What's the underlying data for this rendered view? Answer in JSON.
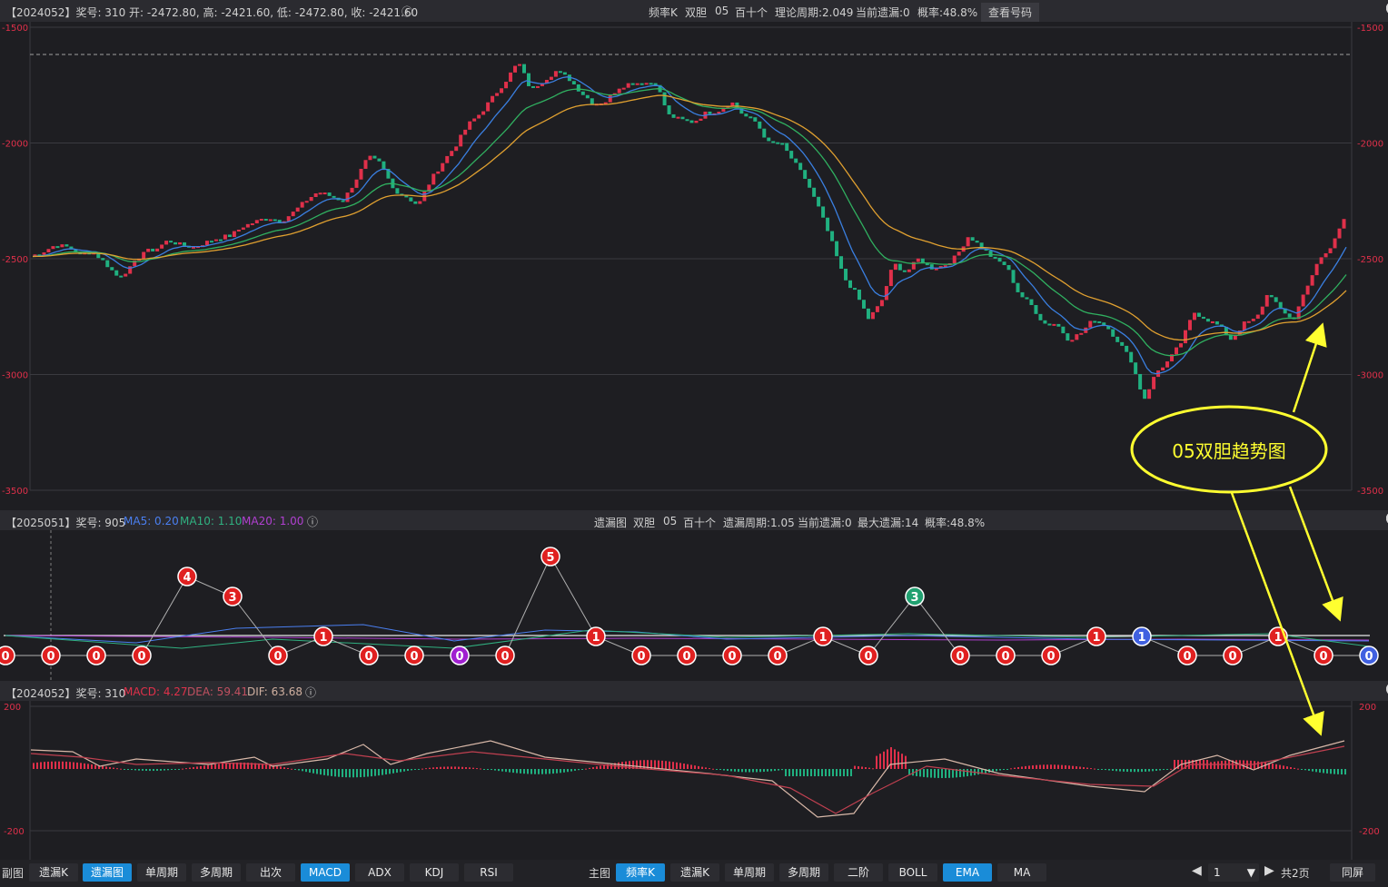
{
  "top_header": {
    "info": "【2024052】奖号: 310  开: -2472.80, 高: -2421.60, 低: -2472.80, 收: -2421.60",
    "chart_name": "频率K",
    "type": "双胆",
    "number": "05",
    "position": "百十个",
    "period": "理论周期:2.049",
    "omit": "当前遗漏:0",
    "prob": "概率:48.8%",
    "view_btn": "查看号码"
  },
  "mid_header": {
    "info": "【2025051】奖号: 905",
    "ma5": "MA5: 0.20",
    "ma10": "MA10: 1.10",
    "ma20": "MA20: 1.00",
    "chart_name": "遗漏图",
    "type": "双胆",
    "number": "05",
    "position": "百十个",
    "period": "遗漏周期:1.05",
    "omit": "当前遗漏:0",
    "max_omit": "最大遗漏:14",
    "prob": "概率:48.8%"
  },
  "bottom_header": {
    "info": "【2024052】奖号: 310",
    "macd": "MACD: 4.27",
    "dea": "DEA: 59.41",
    "dif": "DIF: 63.68"
  },
  "annotation": "05双胆趋势图",
  "colors": {
    "up": "#e0304a",
    "down": "#20b080",
    "ma_blue": "#3a7fe0",
    "ma_green": "#30b060",
    "ma_orange": "#e0a030",
    "note": "#ffff30"
  },
  "main_chart": {
    "y_ticks": [
      "-1500",
      "-2000",
      "-2500",
      "-3000",
      "-3500"
    ],
    "price_path": [
      -2490,
      -2470,
      -2440,
      -2450,
      -2480,
      -2470,
      -2520,
      -2580,
      -2540,
      -2470,
      -2460,
      -2420,
      -2440,
      -2450,
      -2430,
      -2410,
      -2400,
      -2360,
      -2340,
      -2320,
      -2340,
      -2300,
      -2250,
      -2210,
      -2230,
      -2250,
      -2160,
      -2060,
      -2090,
      -2200,
      -2230,
      -2270,
      -2160,
      -2080,
      -2010,
      -1920,
      -1870,
      -1800,
      -1730,
      -1650,
      -1770,
      -1730,
      -1690,
      -1720,
      -1780,
      -1830,
      -1820,
      -1760,
      -1740,
      -1740,
      -1740,
      -1880,
      -1900,
      -1910,
      -1870,
      -1860,
      -1820,
      -1880,
      -1910,
      -2000,
      -2000,
      -2080,
      -2160,
      -2280,
      -2420,
      -2580,
      -2650,
      -2760,
      -2690,
      -2520,
      -2560,
      -2500,
      -2540,
      -2530,
      -2490,
      -2400,
      -2450,
      -2500,
      -2530,
      -2650,
      -2700,
      -2780,
      -2780,
      -2850,
      -2820,
      -2760,
      -2790,
      -2860,
      -2940,
      -3110,
      -2990,
      -2940,
      -2860,
      -2730,
      -2760,
      -2790,
      -2850,
      -2780,
      -2760,
      -2640,
      -2730,
      -2760,
      -2620,
      -2510,
      -2450,
      -2320
    ]
  },
  "omission_chart": {
    "values": [
      "0",
      "0",
      "0",
      "0",
      "4",
      "3",
      "0",
      "1",
      "0",
      "0",
      "0",
      "0",
      "5",
      "1",
      "0",
      "0",
      "0",
      "0",
      "1",
      "0",
      "3",
      "0",
      "0",
      "0",
      "1",
      "1",
      "0",
      "0",
      "1",
      "0",
      "0"
    ],
    "xs": [
      6,
      56,
      106,
      156,
      206,
      256,
      306,
      356,
      406,
      456,
      506,
      556,
      606,
      656,
      706,
      756,
      806,
      856,
      906,
      956,
      1007,
      1057,
      1107,
      1157,
      1207,
      1257,
      1307,
      1357,
      1407,
      1457,
      1507
    ],
    "purple": [
      10
    ],
    "blue": [
      25,
      30
    ],
    "green": [
      20
    ]
  },
  "macd_chart": {
    "y_ticks": [
      "200",
      "-200"
    ]
  },
  "bottom_bar": {
    "sub_label": "副图",
    "sub_buttons": [
      "遗漏K",
      "遗漏图",
      "单周期",
      "多周期",
      "出次",
      "MACD",
      "ADX",
      "KDJ",
      "RSI"
    ],
    "main_label": "主图",
    "main_buttons": [
      "频率K",
      "遗漏K",
      "单周期",
      "多周期",
      "二阶",
      "BOLL",
      "EMA",
      "MA"
    ],
    "page_value": "1",
    "total_pages": "共2页",
    "sync_btn": "同屏"
  }
}
